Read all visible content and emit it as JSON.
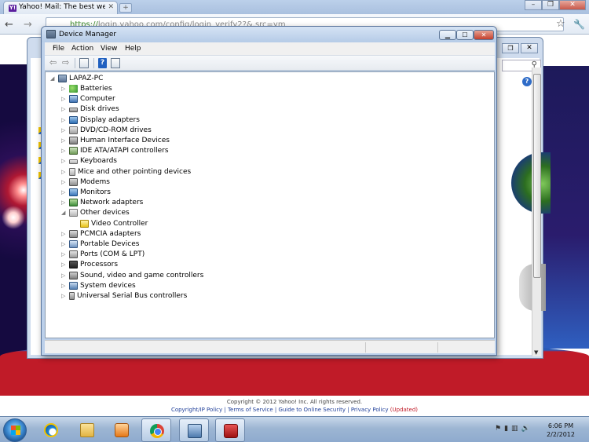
{
  "browser": {
    "tab_title": "Yahoo! Mail: The best web-",
    "tab_favicon": "Y!",
    "url_scheme": "https://",
    "url_rest": "login.yahoo.com/config/login_verify2?&.src=ym"
  },
  "yahoo_footer": {
    "copyright": "Copyright © 2012 Yahoo! Inc. All rights reserved.",
    "links": "Copyright/IP Policy | Terms of Service | Guide to Online Security | Privacy Policy",
    "updated": "(Updated)"
  },
  "device_manager": {
    "title": "Device Manager",
    "menu": [
      "File",
      "Action",
      "View",
      "Help"
    ],
    "root": "LAPAZ-PC",
    "categories": [
      {
        "label": "Batteries",
        "icon": "battery-icon",
        "cls": "i-bat",
        "expanded": false
      },
      {
        "label": "Computer",
        "icon": "computer-icon",
        "cls": "i-cmp",
        "expanded": false
      },
      {
        "label": "Disk drives",
        "icon": "disk-drive-icon",
        "cls": "i-disk",
        "expanded": false
      },
      {
        "label": "Display adapters",
        "icon": "display-adapter-icon",
        "cls": "i-disp",
        "expanded": false
      },
      {
        "label": "DVD/CD-ROM drives",
        "icon": "dvd-drive-icon",
        "cls": "i-dvd",
        "expanded": false
      },
      {
        "label": "Human Interface Devices",
        "icon": "hid-icon",
        "cls": "i-hid",
        "expanded": false
      },
      {
        "label": "IDE ATA/ATAPI controllers",
        "icon": "ide-controller-icon",
        "cls": "i-ide",
        "expanded": false
      },
      {
        "label": "Keyboards",
        "icon": "keyboard-icon",
        "cls": "i-kbd",
        "expanded": false
      },
      {
        "label": "Mice and other pointing devices",
        "icon": "mouse-icon",
        "cls": "i-mouse",
        "expanded": false
      },
      {
        "label": "Modems",
        "icon": "modem-icon",
        "cls": "i-modem",
        "expanded": false
      },
      {
        "label": "Monitors",
        "icon": "monitor-icon",
        "cls": "i-mon",
        "expanded": false
      },
      {
        "label": "Network adapters",
        "icon": "network-adapter-icon",
        "cls": "i-net",
        "expanded": false
      },
      {
        "label": "Other devices",
        "icon": "other-devices-icon",
        "cls": "i-other",
        "expanded": true,
        "children": [
          {
            "label": "Video Controller",
            "icon": "warning-device-icon",
            "cls": "i-warn"
          }
        ]
      },
      {
        "label": "PCMCIA adapters",
        "icon": "pcmcia-icon",
        "cls": "i-pcm",
        "expanded": false
      },
      {
        "label": "Portable Devices",
        "icon": "portable-device-icon",
        "cls": "i-port",
        "expanded": false
      },
      {
        "label": "Ports (COM & LPT)",
        "icon": "port-icon",
        "cls": "i-ports",
        "expanded": false
      },
      {
        "label": "Processors",
        "icon": "processor-icon",
        "cls": "i-cpu",
        "expanded": false
      },
      {
        "label": "Sound, video and game controllers",
        "icon": "sound-icon",
        "cls": "i-snd",
        "expanded": false
      },
      {
        "label": "System devices",
        "icon": "system-device-icon",
        "cls": "i-sys",
        "expanded": false
      },
      {
        "label": "Universal Serial Bus controllers",
        "icon": "usb-icon",
        "cls": "i-usb",
        "expanded": false
      }
    ]
  },
  "taskbar": {
    "time": "6:06 PM",
    "date": "2/2/2012"
  }
}
